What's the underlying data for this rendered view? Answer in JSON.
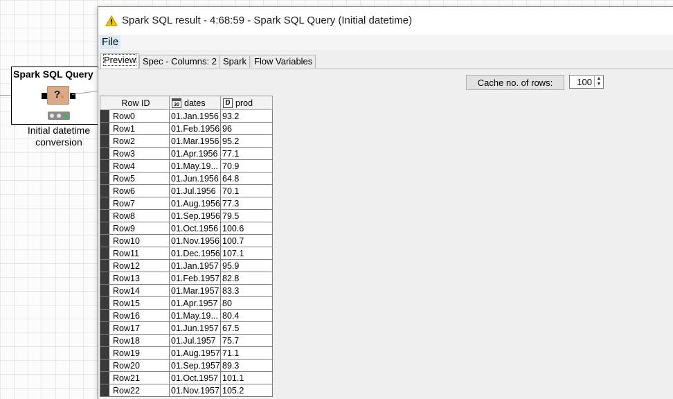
{
  "node": {
    "title": "Spark SQL Query",
    "label_line1": "Initial datetime",
    "label_line2": "conversion",
    "icon_text": "?",
    "icon_star": "★"
  },
  "window": {
    "title": "Spark SQL result - 4:68:59 - Spark SQL Query (Initial datetime)",
    "warning_icon": "warning-triangle-icon"
  },
  "menu": {
    "file": "File"
  },
  "tabs": [
    {
      "label": "Preview",
      "active": true
    },
    {
      "label": "Spec - Columns: 2",
      "active": false
    },
    {
      "label": "Spark",
      "active": false
    },
    {
      "label": "Flow Variables",
      "active": false
    }
  ],
  "toolbar": {
    "cache_label": "Cache no. of rows:",
    "cache_value": "100",
    "spin_up": "▲",
    "spin_down": "▼"
  },
  "table": {
    "columns": [
      {
        "label": "Row ID",
        "type_icon": ""
      },
      {
        "label": "dates",
        "type_icon": "calendar-icon",
        "type_glyph": "30"
      },
      {
        "label": "prod",
        "type_icon": "double-type-icon",
        "type_glyph": "D"
      }
    ],
    "rows": [
      [
        "Row0",
        "01.Jan.1956",
        "93.2"
      ],
      [
        "Row1",
        "01.Feb.1956",
        "96"
      ],
      [
        "Row2",
        "01.Mar.1956",
        "95.2"
      ],
      [
        "Row3",
        "01.Apr.1956",
        "77.1"
      ],
      [
        "Row4",
        "01.May.19...",
        "70.9"
      ],
      [
        "Row5",
        "01.Jun.1956",
        "64.8"
      ],
      [
        "Row6",
        "01.Jul.1956",
        "70.1"
      ],
      [
        "Row7",
        "01.Aug.1956",
        "77.3"
      ],
      [
        "Row8",
        "01.Sep.1956",
        "79.5"
      ],
      [
        "Row9",
        "01.Oct.1956",
        "100.6"
      ],
      [
        "Row10",
        "01.Nov.1956",
        "100.7"
      ],
      [
        "Row11",
        "01.Dec.1956",
        "107.1"
      ],
      [
        "Row12",
        "01.Jan.1957",
        "95.9"
      ],
      [
        "Row13",
        "01.Feb.1957",
        "82.8"
      ],
      [
        "Row14",
        "01.Mar.1957",
        "83.3"
      ],
      [
        "Row15",
        "01.Apr.1957",
        "80"
      ],
      [
        "Row16",
        "01.May.19...",
        "80.4"
      ],
      [
        "Row17",
        "01.Jun.1957",
        "67.5"
      ],
      [
        "Row18",
        "01.Jul.1957",
        "75.7"
      ],
      [
        "Row19",
        "01.Aug.1957",
        "71.1"
      ],
      [
        "Row20",
        "01.Sep.1957",
        "89.3"
      ],
      [
        "Row21",
        "01.Oct.1957",
        "101.1"
      ],
      [
        "Row22",
        "01.Nov.1957",
        "105.2"
      ]
    ]
  },
  "colors": {
    "warning": "#f2c200",
    "node_icon": "#d8a98a",
    "status_ok": "#4caf50",
    "row_marker": "#3a3a3a"
  }
}
